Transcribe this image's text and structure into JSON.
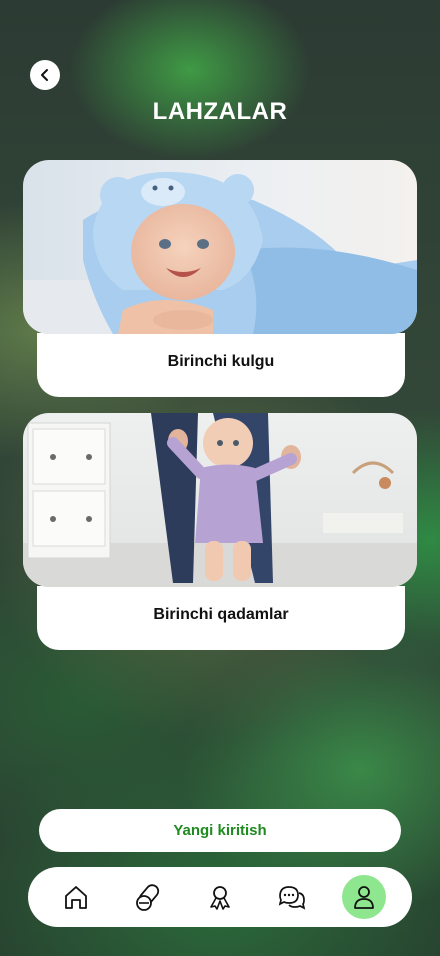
{
  "header": {
    "title": "LAHZALAR"
  },
  "moments": [
    {
      "caption": "Birinchi kulgu",
      "image": "baby-in-blue-hooded-towel"
    },
    {
      "caption": "Birinchi qadamlar",
      "image": "baby-first-steps"
    }
  ],
  "actions": {
    "new_entry_label": "Yangi kiritish"
  },
  "tabbar": {
    "items": [
      {
        "icon": "home-icon",
        "active": false
      },
      {
        "icon": "pills-icon",
        "active": false
      },
      {
        "icon": "award-icon",
        "active": false
      },
      {
        "icon": "chat-icon",
        "active": false
      },
      {
        "icon": "profile-icon",
        "active": true
      }
    ]
  },
  "colors": {
    "accent_green": "#1f8a1f",
    "active_tab_bg": "#8ee68e"
  }
}
